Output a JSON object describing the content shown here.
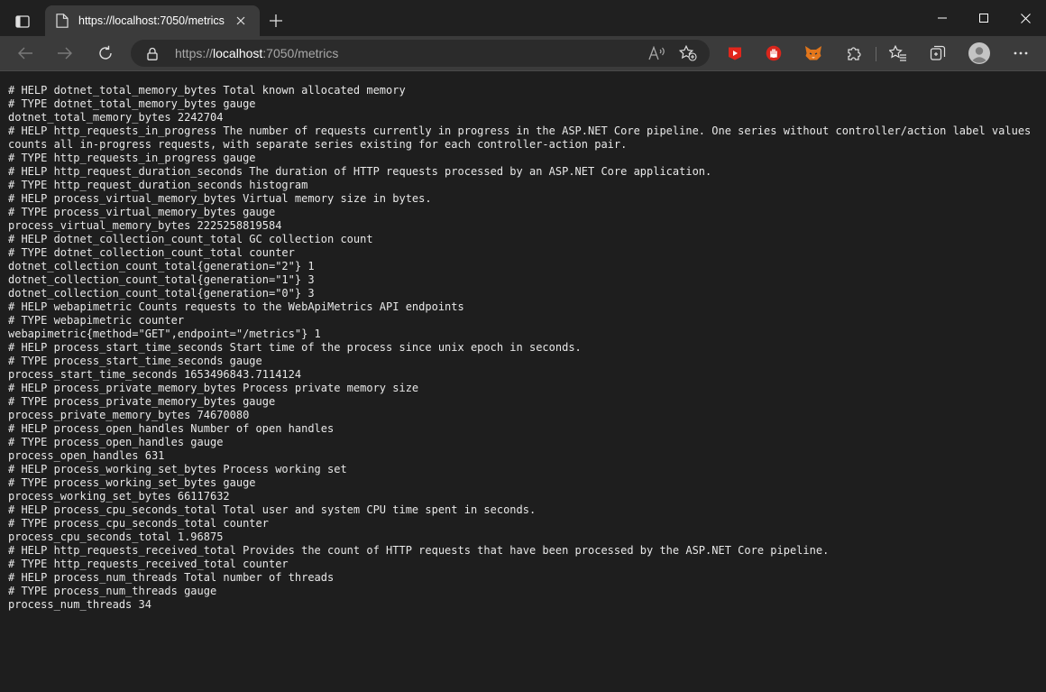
{
  "tab": {
    "title": "https://localhost:7050/metrics"
  },
  "address": {
    "prefix": "https://",
    "host": "localhost",
    "rest": ":7050/metrics"
  },
  "icons": {
    "tab_actions": "tab-actions-icon",
    "favicon": "page-favicon-icon",
    "close": "close-icon",
    "new_tab": "plus-icon",
    "minimize": "minimize-icon",
    "maximize": "maximize-icon",
    "window_close": "close-icon",
    "back": "arrow-left-icon",
    "forward": "arrow-right-icon",
    "refresh": "refresh-icon",
    "lock": "lock-icon",
    "read_aloud": "read-aloud-icon",
    "add_favorite": "star-plus-icon",
    "extension_red": "extension-red-icon",
    "extension_hand": "stop-hand-icon",
    "extension_fox": "fox-icon",
    "extensions": "puzzle-icon",
    "favorites": "favorites-icon",
    "collections": "collections-icon",
    "profile": "avatar-icon",
    "more": "more-icon"
  },
  "colors": {
    "tabstrip": "#202020",
    "toolbar": "#3b3b3b",
    "page": "#1e1e1e",
    "text": "#e8e8e8"
  },
  "metrics": [
    "# HELP dotnet_total_memory_bytes Total known allocated memory",
    "# TYPE dotnet_total_memory_bytes gauge",
    "dotnet_total_memory_bytes 2242704",
    "# HELP http_requests_in_progress The number of requests currently in progress in the ASP.NET Core pipeline. One series without controller/action label values counts all in-progress requests, with separate series existing for each controller-action pair.",
    "# TYPE http_requests_in_progress gauge",
    "# HELP http_request_duration_seconds The duration of HTTP requests processed by an ASP.NET Core application.",
    "# TYPE http_request_duration_seconds histogram",
    "# HELP process_virtual_memory_bytes Virtual memory size in bytes.",
    "# TYPE process_virtual_memory_bytes gauge",
    "process_virtual_memory_bytes 2225258819584",
    "# HELP dotnet_collection_count_total GC collection count",
    "# TYPE dotnet_collection_count_total counter",
    "dotnet_collection_count_total{generation=\"2\"} 1",
    "dotnet_collection_count_total{generation=\"1\"} 3",
    "dotnet_collection_count_total{generation=\"0\"} 3",
    "# HELP webapimetric Counts requests to the WebApiMetrics API endpoints",
    "# TYPE webapimetric counter",
    "webapimetric{method=\"GET\",endpoint=\"/metrics\"} 1",
    "# HELP process_start_time_seconds Start time of the process since unix epoch in seconds.",
    "# TYPE process_start_time_seconds gauge",
    "process_start_time_seconds 1653496843.7114124",
    "# HELP process_private_memory_bytes Process private memory size",
    "# TYPE process_private_memory_bytes gauge",
    "process_private_memory_bytes 74670080",
    "# HELP process_open_handles Number of open handles",
    "# TYPE process_open_handles gauge",
    "process_open_handles 631",
    "# HELP process_working_set_bytes Process working set",
    "# TYPE process_working_set_bytes gauge",
    "process_working_set_bytes 66117632",
    "# HELP process_cpu_seconds_total Total user and system CPU time spent in seconds.",
    "# TYPE process_cpu_seconds_total counter",
    "process_cpu_seconds_total 1.96875",
    "# HELP http_requests_received_total Provides the count of HTTP requests that have been processed by the ASP.NET Core pipeline.",
    "# TYPE http_requests_received_total counter",
    "# HELP process_num_threads Total number of threads",
    "# TYPE process_num_threads gauge",
    "process_num_threads 34"
  ]
}
